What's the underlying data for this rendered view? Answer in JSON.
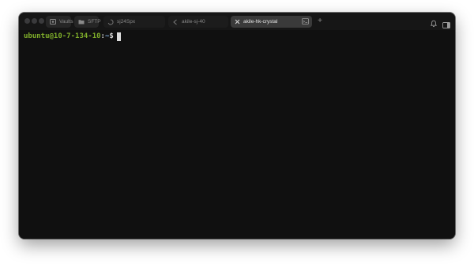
{
  "tabs": {
    "vaults_label": "Vaults",
    "sftp_label": "SFTP",
    "sessions": [
      {
        "label": "sj24Spx",
        "icon": "loading-spinner-icon"
      },
      {
        "label": "akile-sj-40",
        "icon": "arrow-left-icon"
      },
      {
        "label": "akile-hk-crystal",
        "icon": "close-icon",
        "active": true
      }
    ]
  },
  "toolbar": {
    "new_tab": "+",
    "right_icons": [
      "bell-icon",
      "sidebar-toggle-icon"
    ]
  },
  "terminal": {
    "user_host": "ubuntu@10-7-134-10",
    "separator": ":",
    "path": "~",
    "prompt_symbol": "$"
  },
  "colors": {
    "window_bg": "#101010",
    "prompt_green": "#7fae2a",
    "prompt_blue": "#7aa8d8"
  }
}
